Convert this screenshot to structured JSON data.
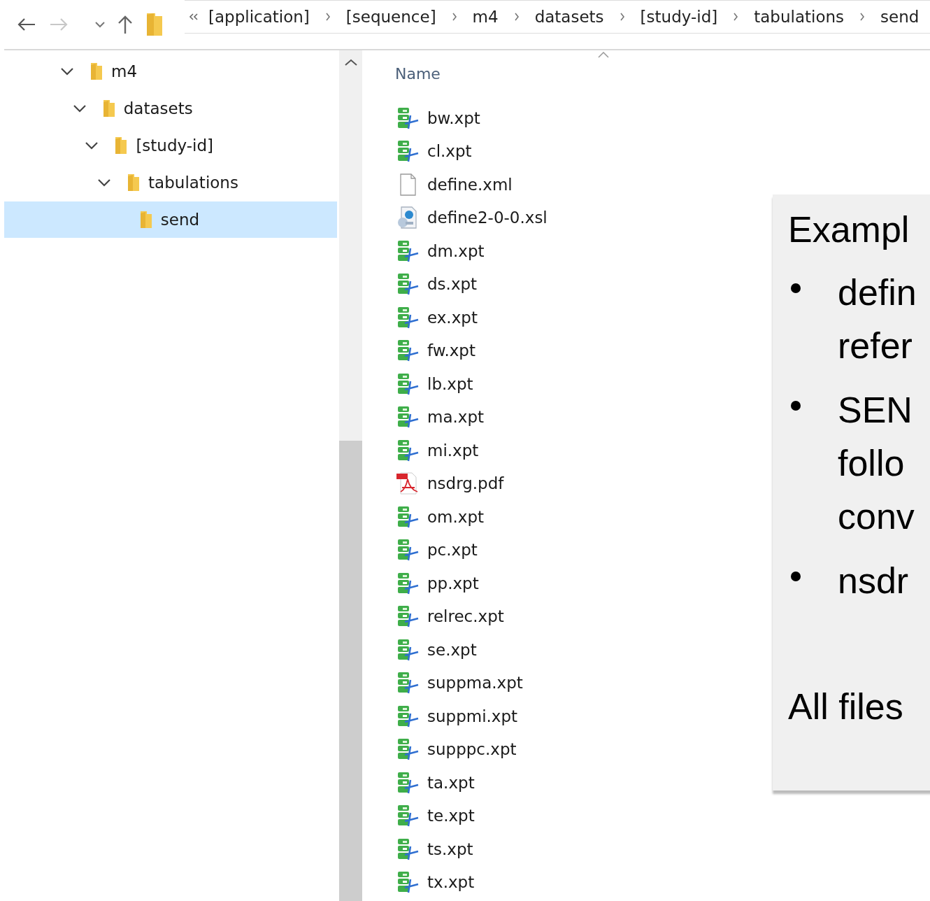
{
  "address_bar": {
    "segments": [
      "[application]",
      "[sequence]",
      "m4",
      "datasets",
      "[study-id]",
      "tabulations",
      "send"
    ]
  },
  "navigation_tree": [
    {
      "label": "m4",
      "expanded": true,
      "selected": false,
      "children": [
        {
          "label": "datasets",
          "expanded": true,
          "selected": false,
          "children": [
            {
              "label": "[study-id]",
              "expanded": true,
              "selected": false,
              "children": [
                {
                  "label": "tabulations",
                  "expanded": true,
                  "selected": false,
                  "children": [
                    {
                      "label": "send",
                      "selected": true
                    }
                  ]
                }
              ]
            }
          ]
        }
      ]
    }
  ],
  "file_list": {
    "columns": [
      "Name"
    ],
    "files": [
      {
        "name": "bw.xpt",
        "kind": "xpt"
      },
      {
        "name": "cl.xpt",
        "kind": "xpt"
      },
      {
        "name": "define.xml",
        "kind": "xml"
      },
      {
        "name": "define2-0-0.xsl",
        "kind": "xsl"
      },
      {
        "name": "dm.xpt",
        "kind": "xpt"
      },
      {
        "name": "ds.xpt",
        "kind": "xpt"
      },
      {
        "name": "ex.xpt",
        "kind": "xpt"
      },
      {
        "name": "fw.xpt",
        "kind": "xpt"
      },
      {
        "name": "lb.xpt",
        "kind": "xpt"
      },
      {
        "name": "ma.xpt",
        "kind": "xpt"
      },
      {
        "name": "mi.xpt",
        "kind": "xpt"
      },
      {
        "name": "nsdrg.pdf",
        "kind": "pdf"
      },
      {
        "name": "om.xpt",
        "kind": "xpt"
      },
      {
        "name": "pc.xpt",
        "kind": "xpt"
      },
      {
        "name": "pp.xpt",
        "kind": "xpt"
      },
      {
        "name": "relrec.xpt",
        "kind": "xpt"
      },
      {
        "name": "se.xpt",
        "kind": "xpt"
      },
      {
        "name": "suppma.xpt",
        "kind": "xpt"
      },
      {
        "name": "suppmi.xpt",
        "kind": "xpt"
      },
      {
        "name": "supppc.xpt",
        "kind": "xpt"
      },
      {
        "name": "ta.xpt",
        "kind": "xpt"
      },
      {
        "name": "te.xpt",
        "kind": "xpt"
      },
      {
        "name": "ts.xpt",
        "kind": "xpt"
      },
      {
        "name": "tx.xpt",
        "kind": "xpt"
      }
    ]
  },
  "callout": {
    "title": "Exampl",
    "bullets": [
      [
        "defin",
        "refer"
      ],
      [
        "SEN",
        "follo",
        "conv"
      ],
      [
        "nsdr"
      ]
    ],
    "footer": "All files"
  }
}
